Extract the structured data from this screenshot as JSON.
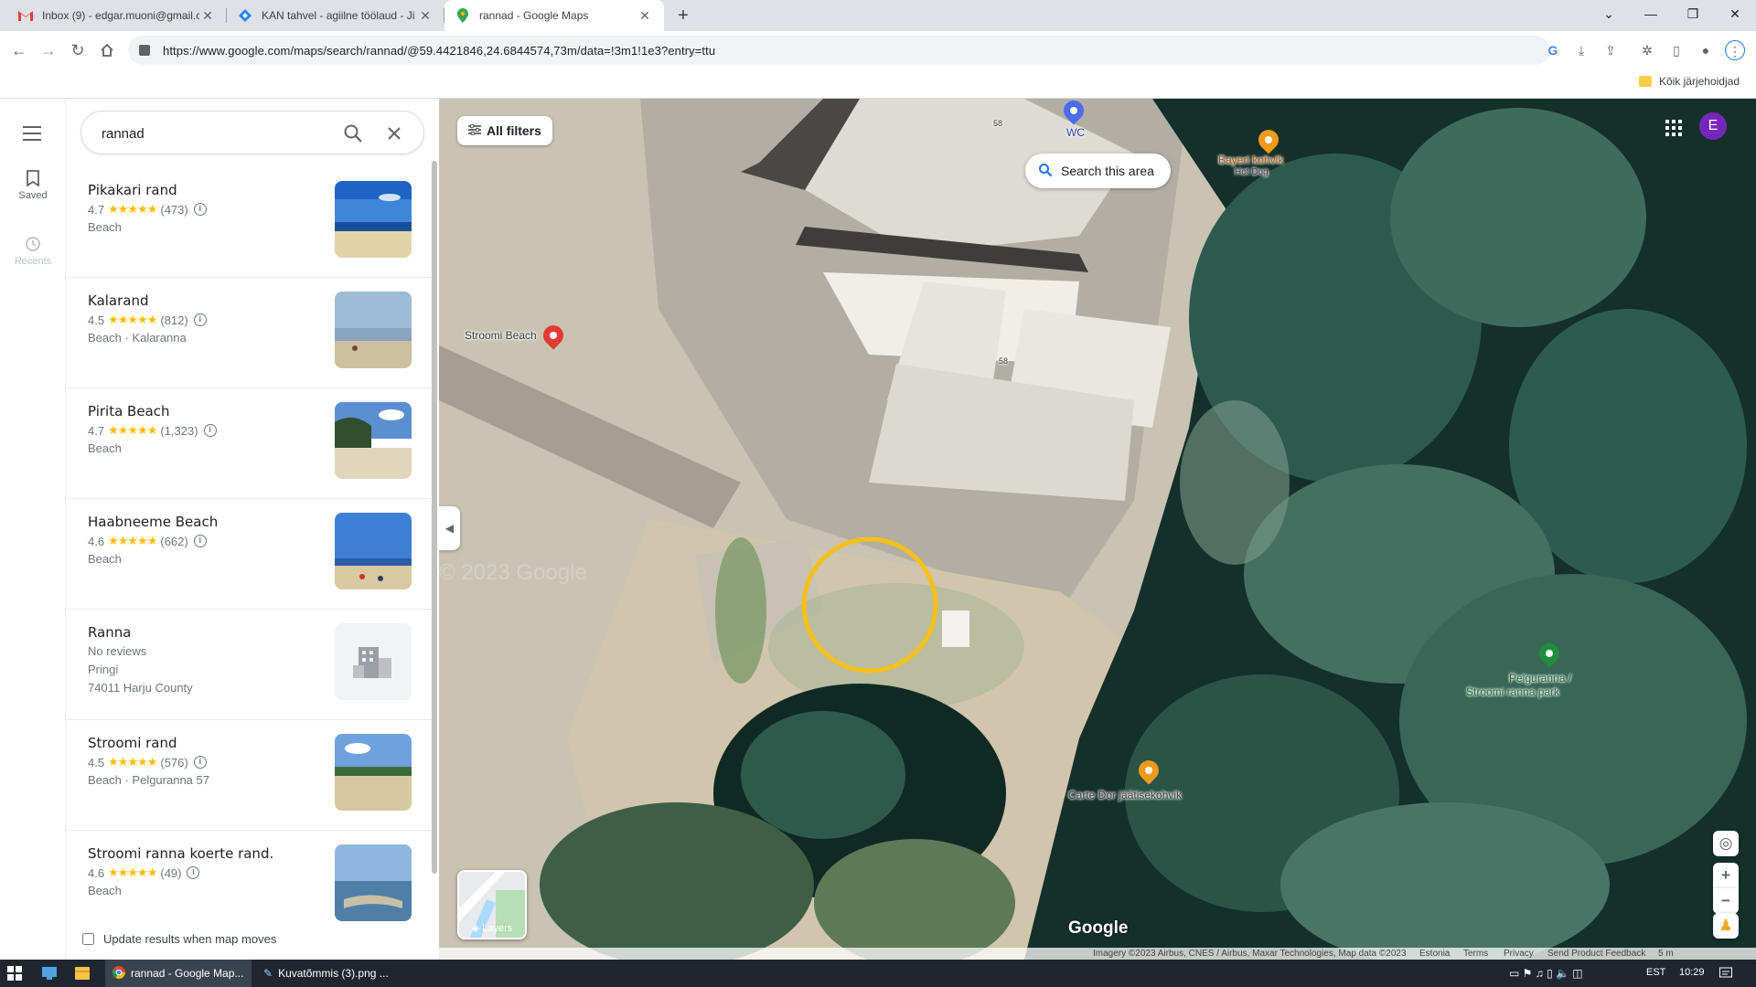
{
  "browser": {
    "tabs": [
      {
        "title": "Inbox (9) - edgar.muoni@gmail.c",
        "icon": "gmail-icon"
      },
      {
        "title": "KAN tahvel - agiilne töölaud - Ji",
        "icon": "jira-icon"
      },
      {
        "title": "rannad - Google Maps",
        "icon": "maps-icon"
      }
    ],
    "url": "https://www.google.com/maps/search/rannad/@59.4421846,24.6844574,73m/data=!3m1!1e3?entry=ttu",
    "bookmarks_all": "Kõik järjehoidjad"
  },
  "rail": {
    "saved": "Saved",
    "recents": "Recents"
  },
  "search": {
    "query": "rannad"
  },
  "results": [
    {
      "name": "Pikakari rand",
      "rating": "4.7",
      "reviews": "(473)",
      "line1": "Beach",
      "line2": "",
      "line3": "",
      "has_rating": true
    },
    {
      "name": "Kalarand",
      "rating": "4.5",
      "reviews": "(812)",
      "line1": "Beach · Kalaranna",
      "line2": "",
      "line3": "",
      "has_rating": true
    },
    {
      "name": "Pirita Beach",
      "rating": "4.7",
      "reviews": "(1,323)",
      "line1": "Beach",
      "line2": "",
      "line3": "",
      "has_rating": true
    },
    {
      "name": "Haabneeme Beach",
      "rating": "4.6",
      "reviews": "(662)",
      "line1": "Beach",
      "line2": "",
      "line3": "",
      "has_rating": true
    },
    {
      "name": "Ranna",
      "rating": "",
      "reviews": "",
      "line1": "No reviews",
      "line2": "Pringi",
      "line3": "74011 Harju County",
      "has_rating": false
    },
    {
      "name": "Stroomi rand",
      "rating": "4.5",
      "reviews": "(576)",
      "line1": "Beach · Pelguranna 57",
      "line2": "",
      "line3": "",
      "has_rating": true
    },
    {
      "name": "Stroomi ranna koerte rand.",
      "rating": "4.6",
      "reviews": "(49)",
      "line1": "Beach",
      "line2": "",
      "line3": "",
      "has_rating": true
    }
  ],
  "update_results_label": "Update results when map moves",
  "map": {
    "all_filters": "All filters",
    "search_this_area": "Search this area",
    "avatar_letter": "E",
    "layers_label": "Layers",
    "google_logo": "Google",
    "watermark": "© 2023 Google",
    "labels": {
      "wc": "WC",
      "bayeri": "Bayeri kohvik",
      "hotdog": "Hot Dog",
      "stroomi_beach": "Stroomi Beach",
      "pelguranna": "Pelguranna /",
      "pelguranna2": "Stroomi ranna park",
      "carte_dor": "Carte Dor jäätisekohvik",
      "house58a": "58",
      "house58b": "58"
    },
    "attribution": {
      "imagery": "Imagery ©2023 Airbus, CNES / Airbus, Maxar Technologies, Map data ©2023",
      "country": "Estonia",
      "terms": "Terms",
      "privacy": "Privacy",
      "feedback": "Send Product Feedback",
      "scale": "5 m"
    }
  },
  "taskbar": {
    "chrome_item": "rannad - Google Map...",
    "image_item": "Kuvatõmmis (3).png ...",
    "lang": "EST",
    "time": "10:29"
  }
}
